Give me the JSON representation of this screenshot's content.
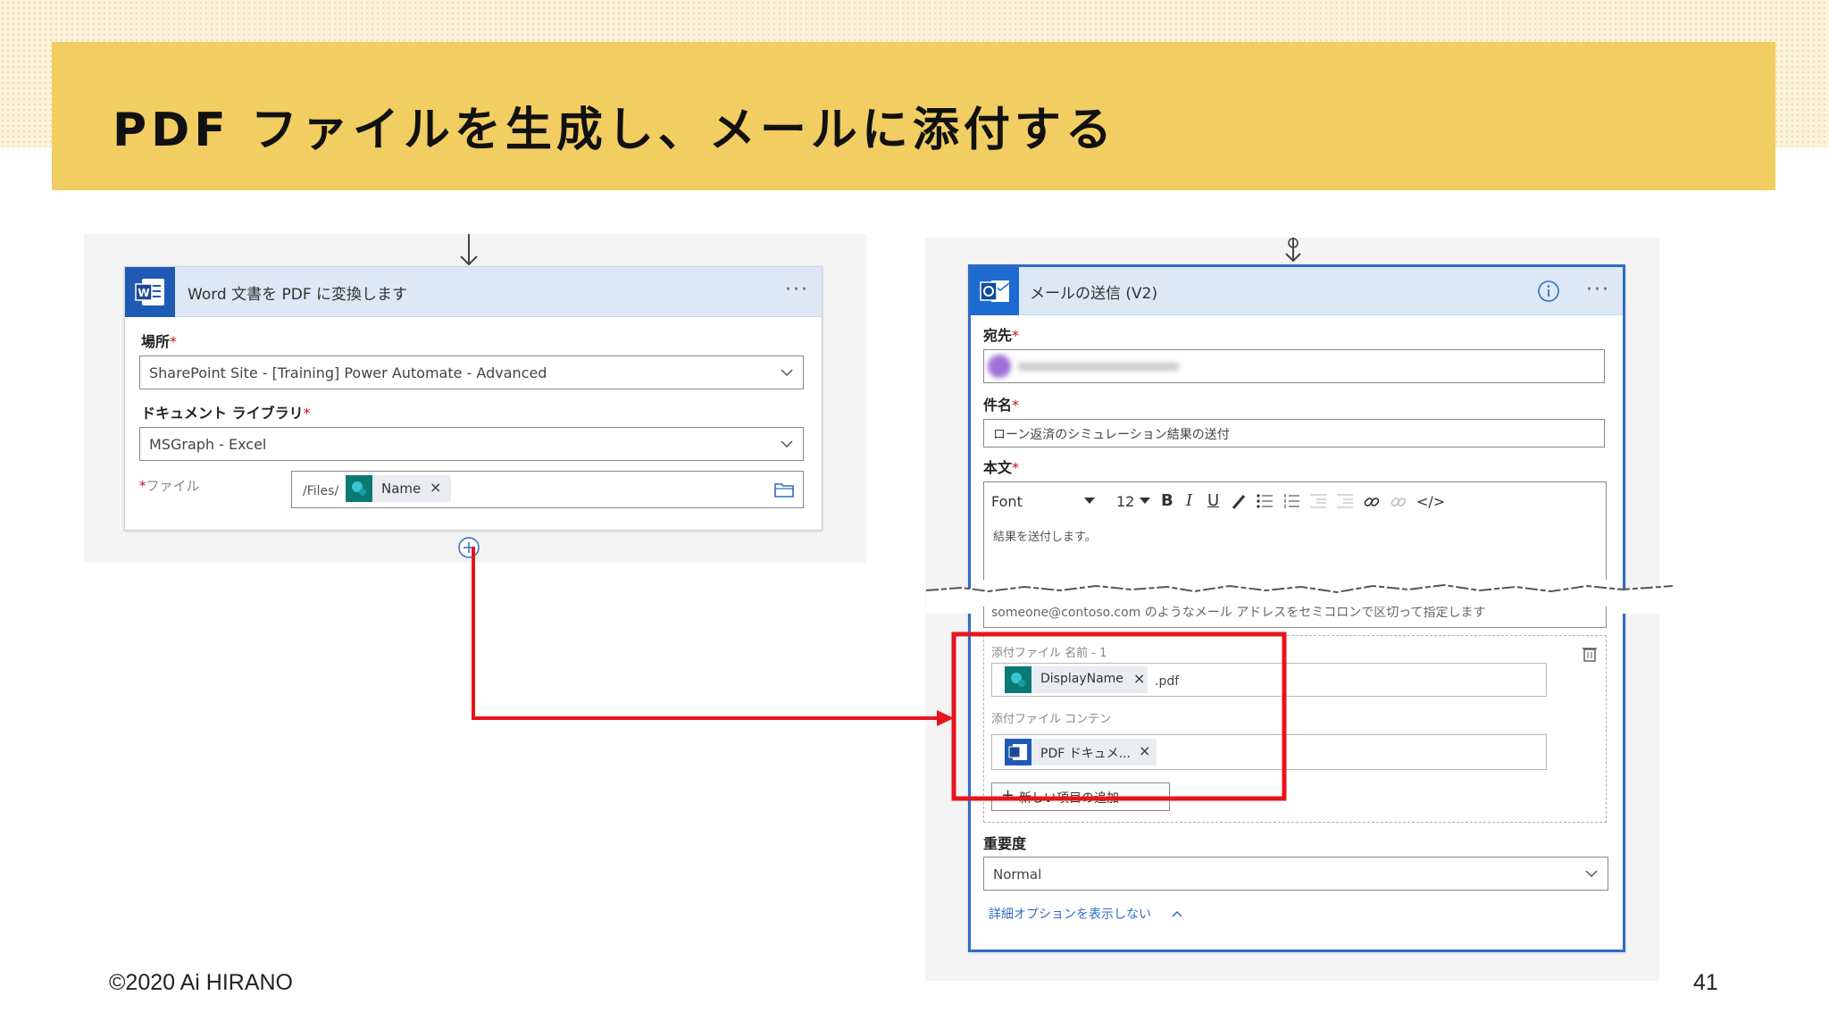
{
  "slide": {
    "title": "PDF ファイルを生成し、メールに添付する",
    "copyright": "©2020 Ai HIRANO",
    "page_number": "41",
    "accent_color": "#f2cd62",
    "arrow_color": "#e8141b"
  },
  "left_card": {
    "title": "Word 文書を PDF に変換します",
    "location_label": "場所",
    "location_value": "SharePoint Site - [Training] Power Automate - Advanced",
    "library_label": "ドキュメント ライブラリ",
    "library_value": "MSGraph - Excel",
    "file_label": "ファイル",
    "file_prefix": "/Files/",
    "file_token": "Name",
    "token_close": "×"
  },
  "right_card": {
    "title": "メールの送信 (V2)",
    "to_label": "宛先",
    "subject_label": "件名",
    "subject_value": "ローン返済のシミュレーション結果の送付",
    "body_label": "本文",
    "toolbar": {
      "font": "Font",
      "size": "12",
      "bold": "B",
      "italic": "I",
      "underline": "U",
      "code": "</>"
    },
    "body_text": "結果を送付します。",
    "email_hint": "someone@contoso.com のようなメール アドレスをセミコロンで区切って指定します",
    "attach_name_label": "添付ファイル 名前 - 1",
    "attach_name_token": "DisplayName",
    "attach_name_suffix": ".pdf",
    "attach_content_label": "添付ファイル コンテン",
    "attach_content_token": "PDF ドキュメ...",
    "add_item": "新しい項目の追加",
    "importance_label": "重要度",
    "importance_value": "Normal",
    "hide_options": "詳細オプションを表示しない"
  }
}
